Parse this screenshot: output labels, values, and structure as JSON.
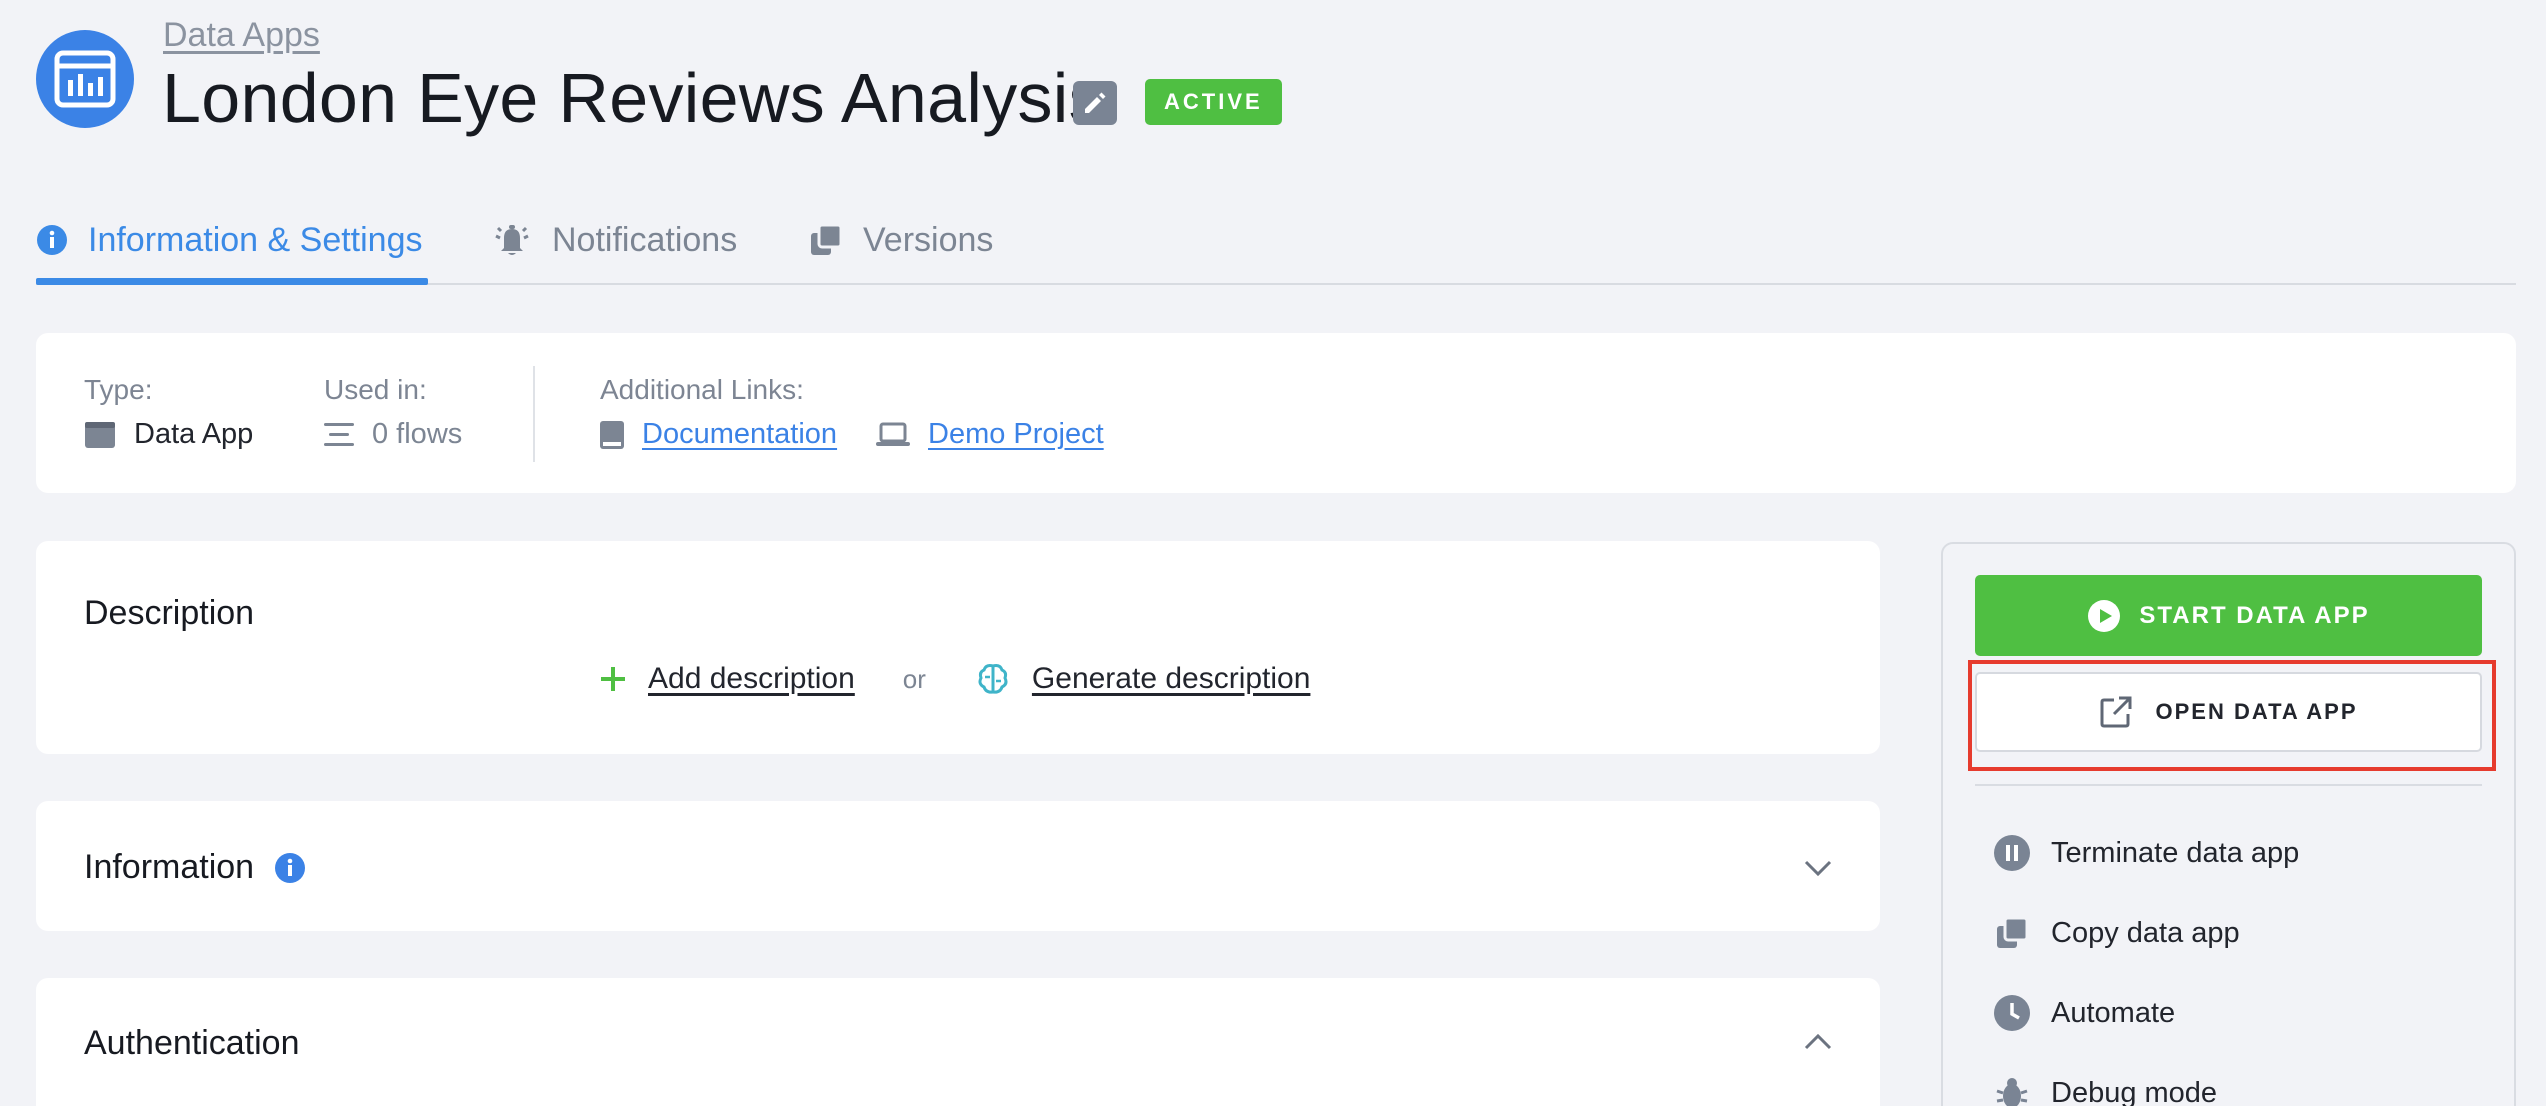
{
  "header": {
    "breadcrumb": "Data Apps",
    "title": "London Eye Reviews Analysis",
    "status": "ACTIVE"
  },
  "tabs": [
    {
      "label": "Information & Settings",
      "active": true,
      "icon": "info-circle-icon"
    },
    {
      "label": "Notifications",
      "active": false,
      "icon": "bell-icon"
    },
    {
      "label": "Versions",
      "active": false,
      "icon": "copy-icon"
    }
  ],
  "info": {
    "type_label": "Type:",
    "type_value": "Data App",
    "used_in_label": "Used in:",
    "used_in_value": "0 flows",
    "links_label": "Additional Links:",
    "links": [
      {
        "label": "Documentation",
        "icon": "book-icon"
      },
      {
        "label": "Demo Project",
        "icon": "laptop-icon"
      }
    ]
  },
  "description": {
    "title": "Description",
    "add_label": "Add description",
    "or_label": "or",
    "generate_label": "Generate description"
  },
  "sections": {
    "information_title": "Information",
    "authentication_title": "Authentication"
  },
  "panel": {
    "start_label": "START DATA APP",
    "open_label": "OPEN DATA APP",
    "actions": [
      {
        "label": "Terminate data app",
        "icon": "pause-circle-icon"
      },
      {
        "label": "Copy data app",
        "icon": "copy-icon"
      },
      {
        "label": "Automate",
        "icon": "clock-icon"
      },
      {
        "label": "Debug mode",
        "icon": "bug-icon"
      }
    ]
  },
  "colors": {
    "accent": "#3b82e6",
    "success": "#4fbf42",
    "highlight": "#e63b2e"
  }
}
